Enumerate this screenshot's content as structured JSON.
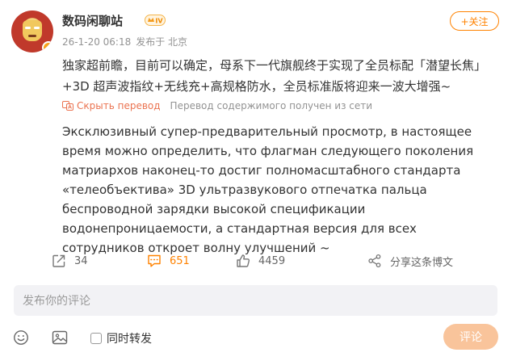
{
  "post": {
    "username": "数码闲聊站",
    "vip_level": "IV",
    "timestamp": "26-1-20 06:18",
    "source": "发布于 北京",
    "follow_label": "+关注",
    "content_line1": "独家超前瞻，目前可以确定，母系下一代旗舰终于实现了全员标配「潜望长焦」",
    "content_line2": "+3D 超声波指纹+无线充+高规格防水，全员标准版将迎来一波大增强~",
    "translation": {
      "hide_label": "Скрыть перевод",
      "note": "Перевод содержимого получен из сети",
      "text": "Эксклюзивный супер-предварительный просмотр, в настоящее время можно определить, что флагман следующего поколения матриархов наконец-то достиг полномасштабного стандарта «телеобъектива» 3D ультразвукового отпечатка пальца беспроводной зарядки высокой спецификации водонепроницаемости, а стандартная версия для всех сотрудников откроет волну улучшений ~"
    }
  },
  "actions": {
    "repost_count": "34",
    "comment_count": "651",
    "like_count": "4459",
    "share_label": "分享这条博文"
  },
  "comment_box": {
    "placeholder": "发布你的评论",
    "forward_label": "同时转发",
    "submit_label": "评论"
  },
  "colors": {
    "accent": "#ff8200",
    "translation_link": "#eb7350",
    "submit_bg": "#f9c49b"
  },
  "icons": [
    "avatar",
    "vip-crown-icon",
    "translate-icon",
    "repost-icon",
    "comment-icon",
    "like-icon",
    "share-icon",
    "emoji-icon",
    "image-icon",
    "checkbox"
  ]
}
